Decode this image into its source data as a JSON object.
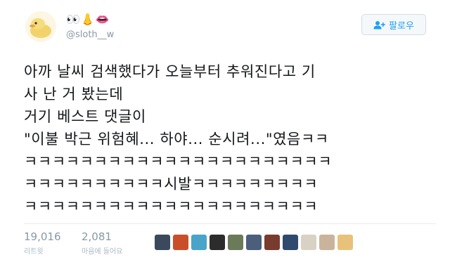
{
  "author": {
    "display_name": "👀👃👄",
    "handle": "@sloth__w"
  },
  "follow_button": {
    "label": "팔로우"
  },
  "tweet": {
    "text": "아까 날씨 검색했다가 오늘부터 추워진다고 기\n사 난 거 봤는데\n거기 베스트 댓글이\n\"이불 박근 위험혜... 하야... 순시려...\"였음ㅋㅋ\nㅋㅋㅋㅋㅋㅋㅋㅋㅋㅋㅋㅋㅋㅋㅋㅋㅋㅋㅋㅋㅋㅋ\nㅋㅋㅋㅋㅋㅋㅋㅋㅋㅋ시발ㅋㅋㅋㅋㅋㅋㅋㅋㅋ\nㅋㅋㅋㅋㅋㅋㅋㅋㅋㅋㅋㅋㅋㅋㅋㅋㅋㅋㅋㅋㅋ"
  },
  "stats": {
    "retweets": {
      "count": "19,016",
      "label": "리트윗"
    },
    "likes": {
      "count": "2,081",
      "label": "마음에 들어요"
    }
  },
  "likers_colors": [
    "#3a4a5c",
    "#c94f2a",
    "#4aa3c9",
    "#2c2c2c",
    "#6b7b5a",
    "#4b5f7d",
    "#7a3b2f",
    "#2f4a6d",
    "#d9d2c4",
    "#c9b49b",
    "#e8c27a"
  ],
  "colors": {
    "accent": "#1da1f2",
    "muted": "#8899a6"
  }
}
